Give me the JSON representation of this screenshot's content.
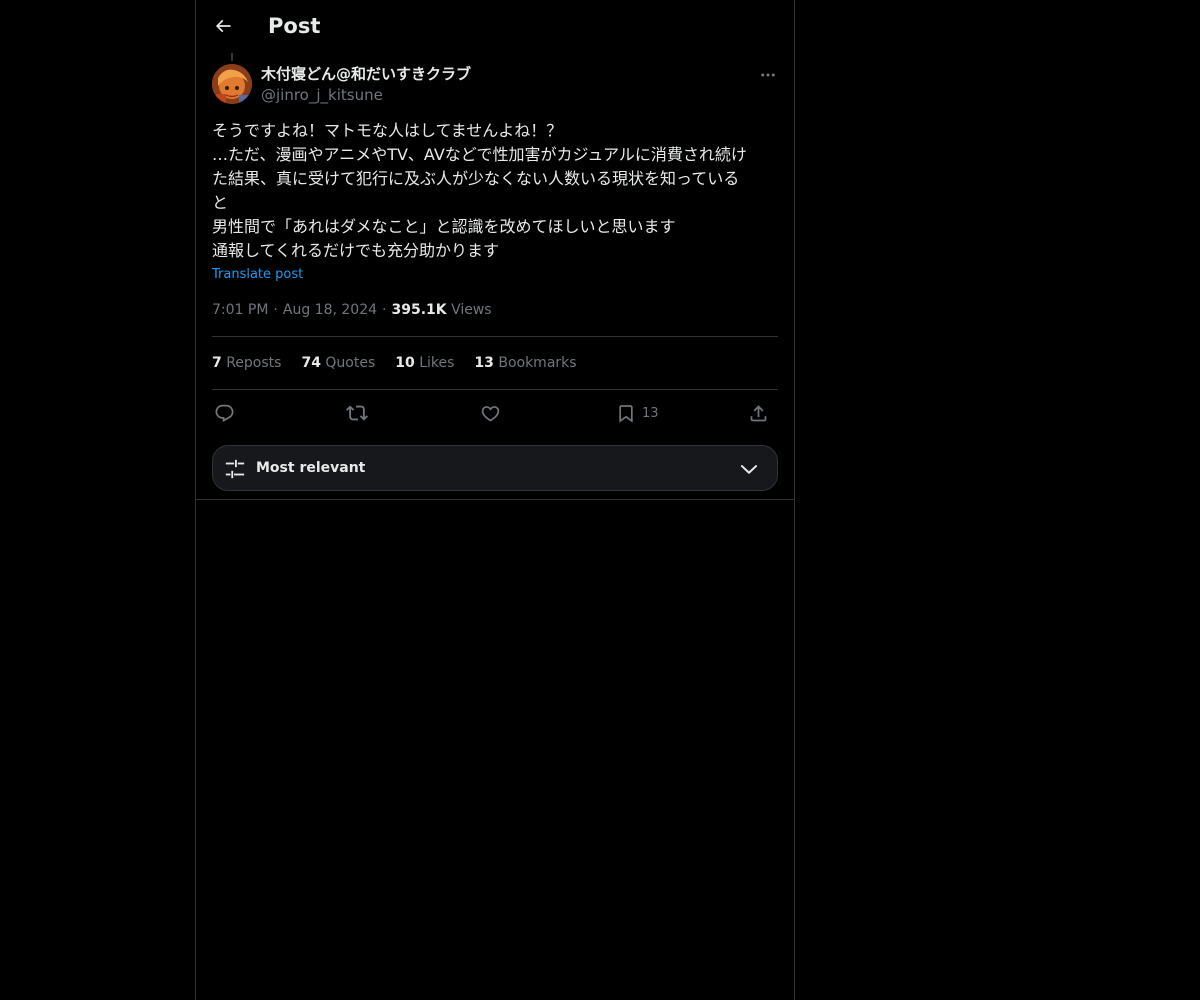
{
  "header": {
    "title": "Post"
  },
  "post": {
    "author": {
      "display_name": "木付寝どん@和だいすきクラブ",
      "handle": "@jinro_j_kitsune"
    },
    "text_lines": [
      "そうですよね！マトモな人はしてませんよね！？",
      "…ただ、漫画やアニメやTV、AVなどで性加害がカジュアルに消費され続け",
      "た結果、真に受けて犯行に及ぶ人が少なくない人数いる現状を知っている",
      "と",
      "男性間で「あれはダメなこと」と認識を改めてほしいと思います",
      "通報してくれるだけでも充分助かります"
    ],
    "translate_label": "Translate post",
    "time": "7:01 PM",
    "date": "Aug 18, 2024",
    "views_count": "395.1K",
    "views_label": "Views",
    "separator": "·"
  },
  "stats": {
    "reposts": {
      "count": "7",
      "label": "Reposts"
    },
    "quotes": {
      "count": "74",
      "label": "Quotes"
    },
    "likes": {
      "count": "10",
      "label": "Likes"
    },
    "bookmarks": {
      "count": "13",
      "label": "Bookmarks"
    }
  },
  "actions": {
    "reply_icon": "reply-icon",
    "repost_icon": "repost-icon",
    "like_icon": "heart-icon",
    "bookmark_icon": "bookmark-icon",
    "bookmark_count": "13",
    "share_icon": "share-icon"
  },
  "sort": {
    "label": "Most relevant",
    "icon": "sliders-icon"
  },
  "colors": {
    "background": "#000000",
    "border": "#2f3336",
    "text_primary": "#e7e9ea",
    "text_secondary": "#71767b",
    "link": "#1d9bf0"
  }
}
